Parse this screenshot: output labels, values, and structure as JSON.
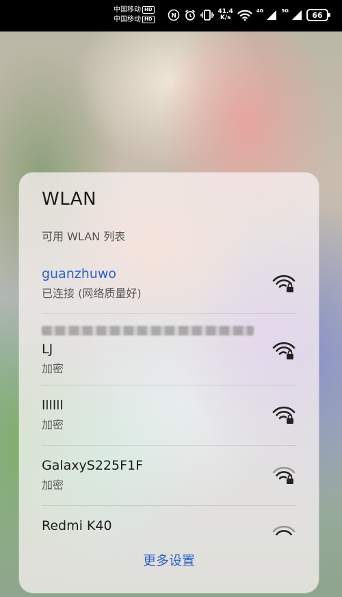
{
  "status_bar": {
    "carrier_1": "中国移动",
    "carrier_2": "中国移动",
    "hd_badge": "HD",
    "speed_value": "41.4",
    "speed_unit": "K/s",
    "sim1_label": "4G",
    "sim2_label": "5G",
    "battery_level": "66",
    "icons": [
      "nfc-icon",
      "alarm-icon",
      "vibrate-icon",
      "wifi-icon",
      "signal-icon",
      "signal-icon",
      "battery-icon"
    ]
  },
  "wlan_panel": {
    "title": "WLAN",
    "subtitle": "可用 WLAN 列表",
    "networks": [
      {
        "name": "guanzhuwo",
        "status": "已连接 (网络质量好)",
        "connected": true,
        "signal_bars": 3,
        "locked": true
      },
      {
        "name": "LJ",
        "status": "加密",
        "connected": false,
        "signal_bars": 3,
        "locked": true
      },
      {
        "name": "llllll",
        "status": "加密",
        "connected": false,
        "signal_bars": 3,
        "locked": true
      },
      {
        "name": "GalaxyS225F1F",
        "status": "加密",
        "connected": false,
        "signal_bars": 2,
        "locked": true
      },
      {
        "name": "Redmi K40",
        "status": "",
        "connected": false,
        "signal_bars": 1,
        "locked": false
      }
    ],
    "more_settings": "更多设置"
  },
  "colors": {
    "accent": "#2b63c8",
    "status_bar_bg": "#000000"
  }
}
